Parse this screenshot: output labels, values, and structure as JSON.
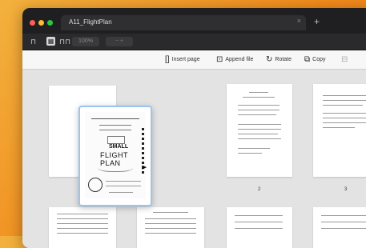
{
  "window": {
    "tab_title": "A11_FlightPlan",
    "tab_close": "×",
    "new_tab": "+"
  },
  "toolbar": {
    "view_single_icon": "⊓",
    "view_grid_icon": "▦",
    "view_spread_icon": "⊓⊓",
    "zoom_value": "100%",
    "zoom_controls": "−  +"
  },
  "actions": {
    "insert_page": "Insert page",
    "append_file": "Append file",
    "rotate": "Rotate",
    "copy": "Copy"
  },
  "selected_page": {
    "title_line1": "SMALL",
    "title_line2": "FLIGHT PLAN"
  },
  "pages": [
    {
      "number": ""
    },
    {
      "number": "2"
    },
    {
      "number": "3"
    }
  ]
}
